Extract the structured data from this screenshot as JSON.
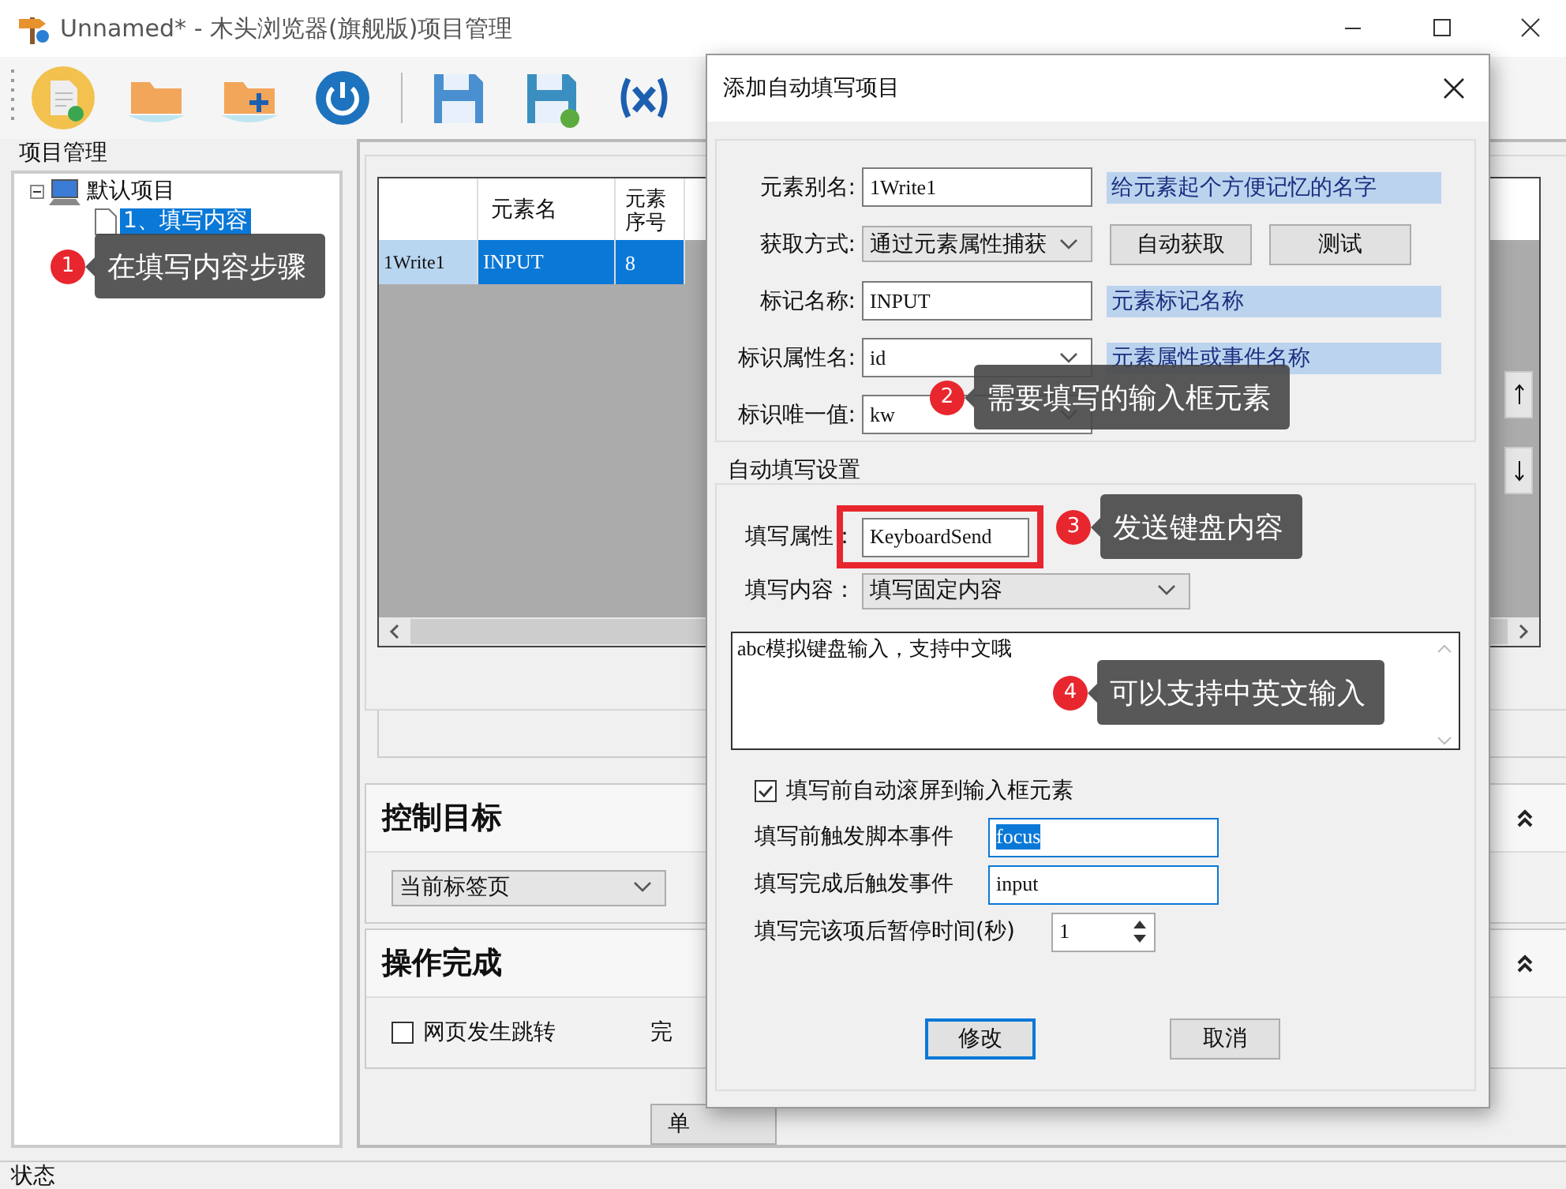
{
  "window": {
    "title": "Unnamed* - 木头浏览器(旗舰版)项目管理"
  },
  "project_panel": {
    "title": "项目管理",
    "tree": [
      {
        "label": "默认项目",
        "expanded": true,
        "selected": false,
        "children": [
          {
            "label": "1、填写内容",
            "selected": true
          }
        ]
      }
    ]
  },
  "element_table": {
    "columns": [
      "元素名",
      "元素序号"
    ],
    "rows": [
      {
        "header": "1Write1",
        "cells": [
          "INPUT",
          "8"
        ],
        "selected": true
      }
    ]
  },
  "control_target": {
    "title": "控制目标",
    "expanded": true,
    "target": "当前标签页"
  },
  "operation_done": {
    "title": "操作完成",
    "expanded": true,
    "page_jump": {
      "label": "网页发生跳转",
      "checked": false
    },
    "column_2": "完"
  },
  "bottom_buttons": [
    "单"
  ],
  "status_bar": "状态",
  "dialog": {
    "title": "添加自动填写项目",
    "identify_rows": [
      {
        "kind": "input",
        "label": "元素别名:",
        "value": "1Write1",
        "hint": "给元素起个方便记忆的名字"
      },
      {
        "kind": "select",
        "label": "获取方式:",
        "value": "通过元素属性捕获",
        "buttons": [
          "自动获取",
          "测试"
        ]
      },
      {
        "kind": "input",
        "label": "标记名称:",
        "value": "INPUT",
        "hint": "元素标记名称"
      },
      {
        "kind": "combo",
        "label": "标识属性名:",
        "value": "id",
        "hint": "元素属性或事件名称"
      },
      {
        "kind": "combo",
        "label": "标识唯一值:",
        "value": "kw"
      }
    ],
    "fill": {
      "title": "自动填写设置",
      "attribute": {
        "label": "填写属性：",
        "value": "KeyboardSend",
        "highlighted": true
      },
      "content": {
        "label": "填写内容：",
        "value": "填写固定内容"
      },
      "text": "abc模拟键盘输入，支持中文哦",
      "scroll": {
        "label": "填写前自动滚屏到输入框元素",
        "checked": true
      },
      "before_event": {
        "label": "填写前触发脚本事件",
        "value": "focus"
      },
      "after_event": {
        "label": "填写完成后触发事件",
        "value": "input"
      },
      "pause": {
        "label": "填写完该项后暂停时间(秒)",
        "value": "1"
      }
    },
    "buttons": [
      {
        "label": "修改",
        "default": true
      },
      {
        "label": "取消",
        "default": false
      }
    ]
  },
  "callouts": [
    {
      "number": "1",
      "text": "在填写内容步骤"
    },
    {
      "number": "2",
      "text": "需要填写的输入框元素"
    },
    {
      "number": "3",
      "text": "发送键盘内容"
    },
    {
      "number": "4",
      "text": "可以支持中英文输入"
    }
  ]
}
